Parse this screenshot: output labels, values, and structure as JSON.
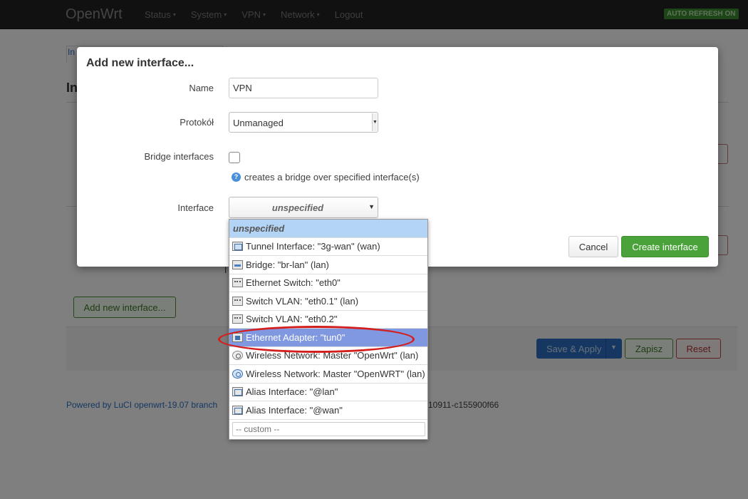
{
  "navbar": {
    "brand": "OpenWrt",
    "menu": [
      {
        "label": "Status",
        "has_caret": true
      },
      {
        "label": "System",
        "has_caret": true
      },
      {
        "label": "VPN",
        "has_caret": true
      },
      {
        "label": "Network",
        "has_caret": true
      },
      {
        "label": "Logout",
        "has_caret": false
      }
    ],
    "caret": "▾",
    "refresh_badge": "AUTO REFRESH ON"
  },
  "background": {
    "tab_fragment": "In",
    "heading_fragment": "In",
    "text_fragment": "I",
    "add_interface_button": "Add new interface...",
    "save_apply_button": "Save & Apply",
    "save_apply_caret": "▼",
    "zapisz_button": "Zapisz",
    "reset_button": "Reset",
    "footer_link": "Powered by LuCI openwrt-19.07 branch",
    "footer_revision": "r10911-c155900f66"
  },
  "modal": {
    "title": "Add new interface...",
    "name_label": "Name",
    "name_value": "VPN",
    "protocol_label": "Protokół",
    "protocol_value": "Unmanaged",
    "bridge_label": "Bridge interfaces",
    "bridge_checked": false,
    "bridge_help": "creates a bridge over specified interface(s)",
    "help_icon_glyph": "?",
    "interface_label": "Interface",
    "interface_value": "unspecified",
    "interface_arrow": "▼",
    "cancel_button": "Cancel",
    "create_button": "Create interface"
  },
  "dropdown": {
    "options": [
      {
        "label": "unspecified",
        "icon": "none",
        "state": "placeholder"
      },
      {
        "label": "Tunnel Interface: \"3g-wan\" (wan)",
        "icon": "tunnel-icon",
        "state": "normal"
      },
      {
        "label": "Bridge: \"br-lan\" (lan)",
        "icon": "bridge-icon",
        "state": "normal"
      },
      {
        "label": "Ethernet Switch: \"eth0\"",
        "icon": "switch-icon",
        "state": "normal"
      },
      {
        "label": "Switch VLAN: \"eth0.1\" (lan)",
        "icon": "switch-icon",
        "state": "normal"
      },
      {
        "label": "Switch VLAN: \"eth0.2\"",
        "icon": "switch-icon",
        "state": "normal"
      },
      {
        "label": "Ethernet Adapter: \"tun0\"",
        "icon": "ethernet-adapter-icon",
        "state": "highlighted"
      },
      {
        "label": "Wireless Network: Master \"OpenWrt\" (lan)",
        "icon": "wifi-icon",
        "state": "normal"
      },
      {
        "label": "Wireless Network: Master \"OpenWRT\" (lan)",
        "icon": "wifi-icon",
        "state": "normal"
      },
      {
        "label": "Alias Interface: \"@lan\"",
        "icon": "alias-icon",
        "state": "normal"
      },
      {
        "label": "Alias Interface: \"@wan\"",
        "icon": "alias-icon",
        "state": "normal"
      }
    ],
    "custom_placeholder": "-- custom --"
  },
  "annotation": {
    "color": "#d41e1e",
    "shape": "ellipse",
    "target": "Ethernet Adapter: \"tun0\""
  }
}
